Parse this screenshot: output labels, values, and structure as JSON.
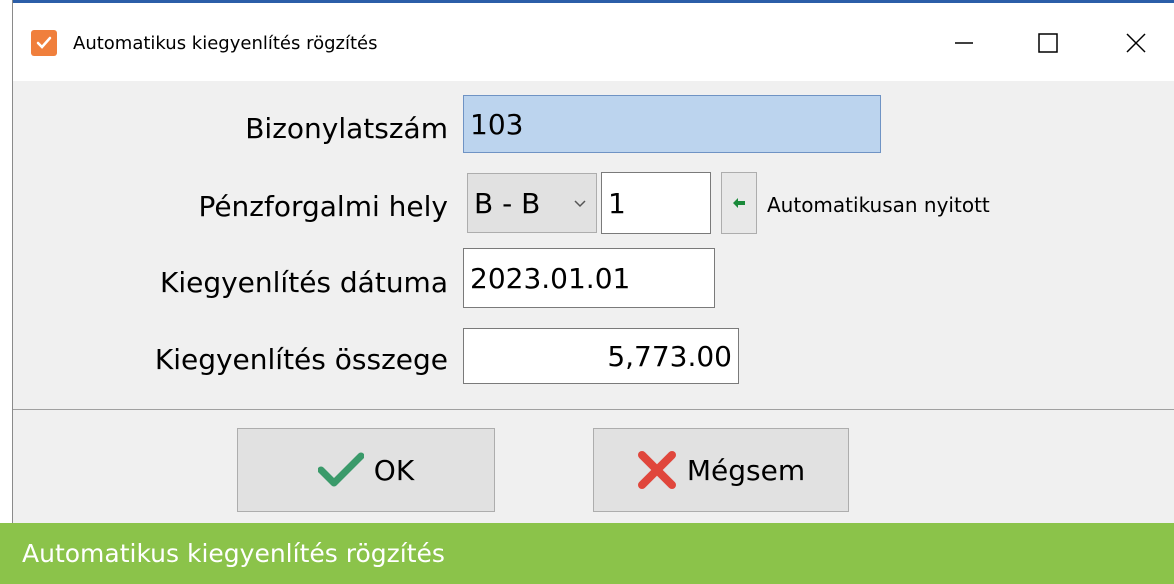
{
  "window": {
    "title": "Automatikus kiegyenlítés rögzítés"
  },
  "form": {
    "doc_number_label": "Bizonylatszám",
    "doc_number_value": "103",
    "cash_place_label": "Pénzforgalmi hely",
    "cash_place_combo_value": "B - B",
    "cash_place_number": "1",
    "cash_place_status": "Automatikusan nyitott",
    "date_label": "Kiegyenlítés dátuma",
    "date_value": "2023.01.01",
    "amount_label": "Kiegyenlítés összege",
    "amount_value": "5,773.00"
  },
  "buttons": {
    "ok_label": "OK",
    "cancel_label": "Mégsem"
  },
  "caption": {
    "text": "Automatikus kiegyenlítés rögzítés"
  },
  "colors": {
    "accent": "#f07f3c",
    "caption_bar": "#8bc34a",
    "selection": "#bcd4ee"
  },
  "icons": {
    "app": "checkbox-icon",
    "ok": "checkmark-icon",
    "cancel": "cross-icon",
    "arrow": "arrow-left-icon"
  }
}
